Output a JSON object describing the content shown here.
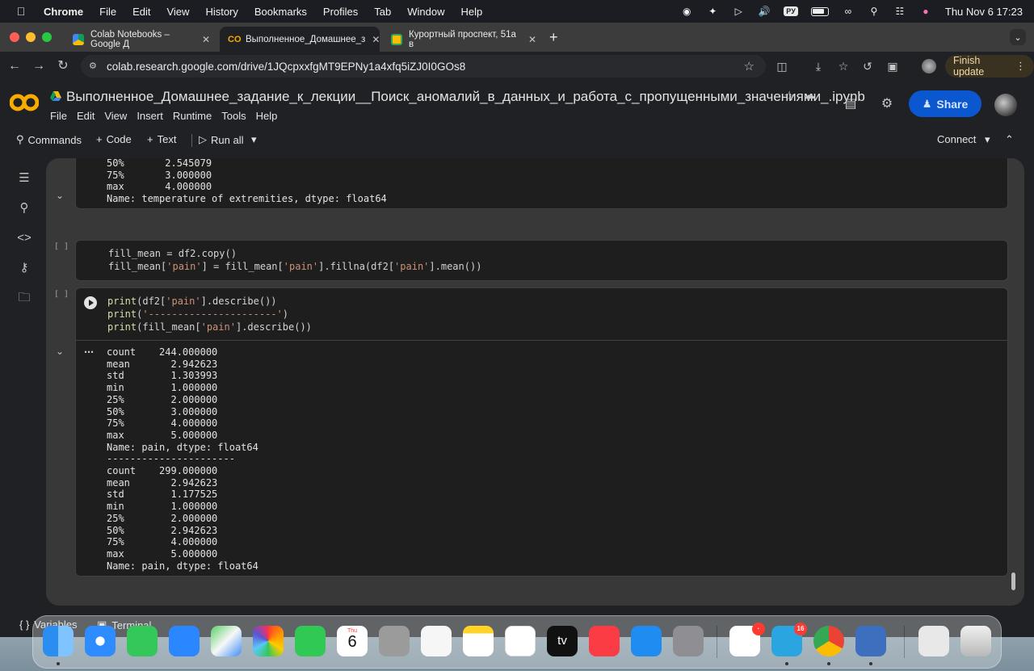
{
  "menubar": {
    "app": "Chrome",
    "items": [
      "File",
      "Edit",
      "View",
      "History",
      "Bookmarks",
      "Profiles",
      "Tab",
      "Window",
      "Help"
    ],
    "input_badge": "PУ",
    "datetime": "Thu Nov 6  17:23"
  },
  "tabs": [
    {
      "title": "Colab Notebooks – Google Д",
      "icon": "google-drive-icon"
    },
    {
      "title": "Выполненное_Домашнее_з",
      "icon": "colab-icon"
    },
    {
      "title": "Курортный проспект, 51а в",
      "icon": "google-maps-icon"
    }
  ],
  "address_bar": {
    "url": "colab.research.google.com/drive/1JQcpxxfgMT9EPNy1a4xfq5iZJ0I0GOs8"
  },
  "finish_update_label": "Finish update",
  "notebook": {
    "title": "Выполненное_Домашнее_задание_к_лекции__Поиск_аномалий_в_данных_и_работа_с_пропущенными_значениями_.ipynb",
    "menu": [
      "File",
      "Edit",
      "View",
      "Insert",
      "Runtime",
      "Tools",
      "Help"
    ],
    "share_label": "Share"
  },
  "command_bar": {
    "commands_label": "Commands",
    "code_label": "Code",
    "text_label": "Text",
    "run_all_label": "Run all",
    "connect_label": "Connect"
  },
  "cells": {
    "output_top": {
      "lines": [
        "50%       2.545079",
        "75%       3.000000",
        "max       4.000000",
        "Name: temperature of extremities, dtype: float64"
      ]
    },
    "cell_a": {
      "exec": "[ ]",
      "line1": "fill_mean = df2.copy()",
      "line2_parts": [
        "fill_mean[",
        "'pain'",
        "] = fill_mean[",
        "'pain'",
        "].fillna(df2[",
        "'pain'",
        "].mean())"
      ]
    },
    "cell_b": {
      "exec": "[ ]",
      "line1_parts": [
        "print",
        "(df2[",
        "'pain'",
        "].describe())"
      ],
      "line2_parts": [
        "print",
        "(",
        "'----------------------'",
        ")"
      ],
      "line3_parts": [
        "print",
        "(fill_mean[",
        "'pain'",
        "].describe())"
      ],
      "output": [
        "count    244.000000",
        "mean       2.942623",
        "std        1.303993",
        "min        1.000000",
        "25%        2.000000",
        "50%        3.000000",
        "75%        4.000000",
        "max        5.000000",
        "Name: pain, dtype: float64",
        "----------------------",
        "count    299.000000",
        "mean       2.942623",
        "std        1.177525",
        "min        1.000000",
        "25%        2.000000",
        "50%        2.942623",
        "75%        4.000000",
        "max        5.000000",
        "Name: pain, dtype: float64"
      ]
    }
  },
  "bottom_bar": {
    "variables_label": "Variables",
    "terminal_label": "Terminal"
  },
  "dock": {
    "calendar_month": "Thu",
    "calendar_day": "6",
    "badge_ai": "·",
    "badge_telegram": "16",
    "tv_label": "tv"
  }
}
